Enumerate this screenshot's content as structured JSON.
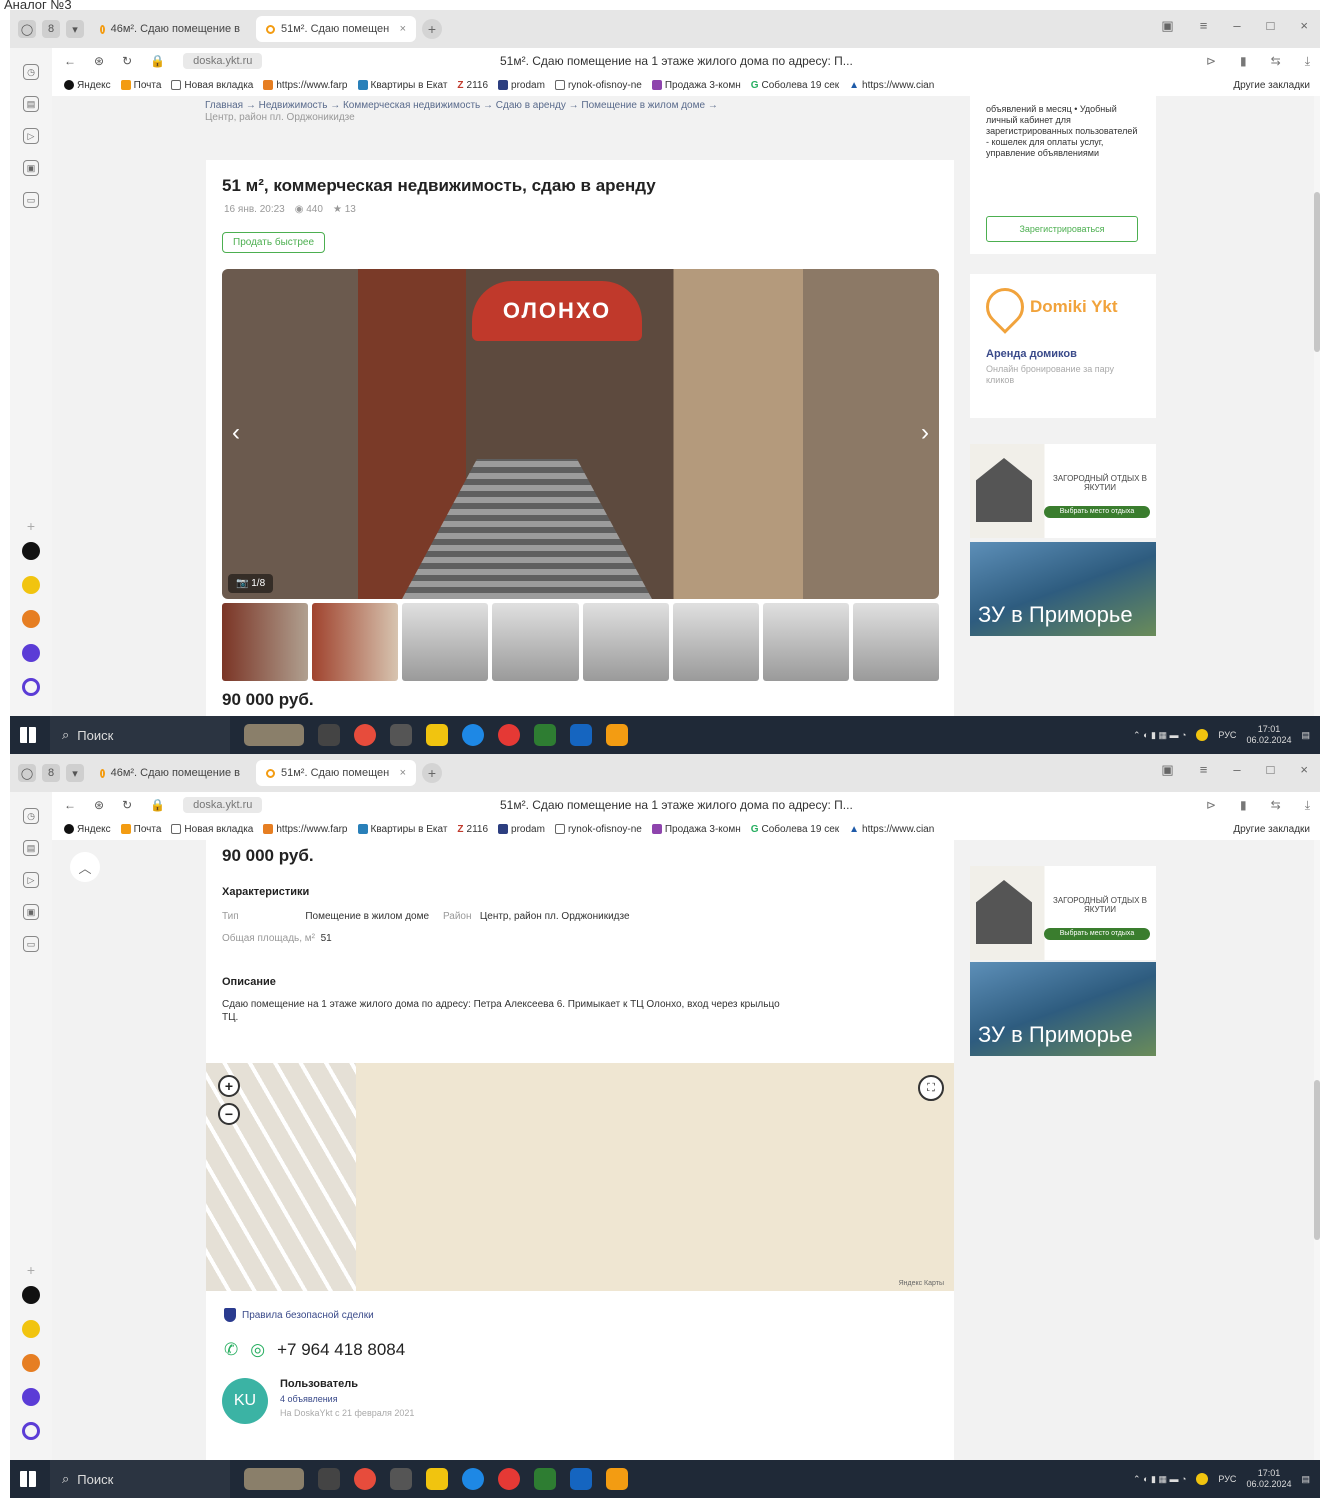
{
  "caption": "Аналог №3",
  "browser": {
    "tabs": [
      {
        "label": "46м². Сдаю помещение в"
      },
      {
        "label": "51м². Сдаю помещен"
      }
    ],
    "address_domain": "doska.ykt.ru",
    "page_title": "51м². Сдаю помещение на 1 этаже жилого дома по адресу: П...",
    "bookmarks": [
      "Яндекс",
      "Почта",
      "Новая вкладка",
      "https://www.farp",
      "Квартиры в Екат",
      "2116",
      "prodam",
      "rynok-ofisnoy-ne",
      "Продажа 3-комн",
      "Соболева 19 сек",
      "https://www.cian"
    ],
    "other_bookmarks": "Другие закладки"
  },
  "listing": {
    "breadcrumbs": "Главная → Недвижимость → Коммерческая недвижимость → Сдаю в аренду → Помещение в жилом доме →",
    "breadcrumbs2": "Центр, район пл. Орджоникидзе",
    "title": "51 м², коммерческая недвижимость, сдаю в аренду",
    "date": "16 янв. 20:23",
    "views": "440",
    "favorites": "13",
    "sell_button": "Продать быстрее",
    "photo_sign": "ОЛОНХО",
    "photo_counter": "1/8",
    "price": "90 000 руб.",
    "characteristics_title": "Характеристики",
    "type_label": "Тип",
    "type_value": "Помещение в жилом доме",
    "district_label": "Район",
    "district_value": "Центр, район пл. Орджоникидзе",
    "area_label": "Общая площадь, м²",
    "area_value": "51",
    "description_title": "Описание",
    "description": "Сдаю помещение на 1 этаже жилого дома по адресу: Петра Алексеева 6. Примыкает к ТЦ Олонхо, вход через крыльцо ТЦ.",
    "safe_deal": "Правила безопасной сделки",
    "phone": "+7 964 418 8084",
    "user_initials": "KU",
    "user_name": "Пользователь",
    "user_count": "4 объявления",
    "user_since": "На DoskaYkt с 21 февраля 2021"
  },
  "sidebar_right": {
    "promo_text": "объявлений в месяц • Удобный личный кабинет для зарегистрированных пользователей - кошелек для оплаты услуг, управление объявлениями",
    "register_button": "Зарегистрироваться",
    "domiki_brand": "Domiki Ykt",
    "domiki_title": "Аренда домиков",
    "domiki_sub": "Онлайн бронирование за пару кликов",
    "ad1_headline": "ЗАГОРОДНЫЙ ОТДЫХ В ЯКУТИИ",
    "ad1_button": "Выбрать место отдыха",
    "ad2_text": "ЗУ в Приморье"
  },
  "map": {
    "footer": "Яндекс Карты"
  },
  "taskbar": {
    "search": "Поиск",
    "lang": "РУС",
    "time": "17:01",
    "date": "06.02.2024"
  }
}
